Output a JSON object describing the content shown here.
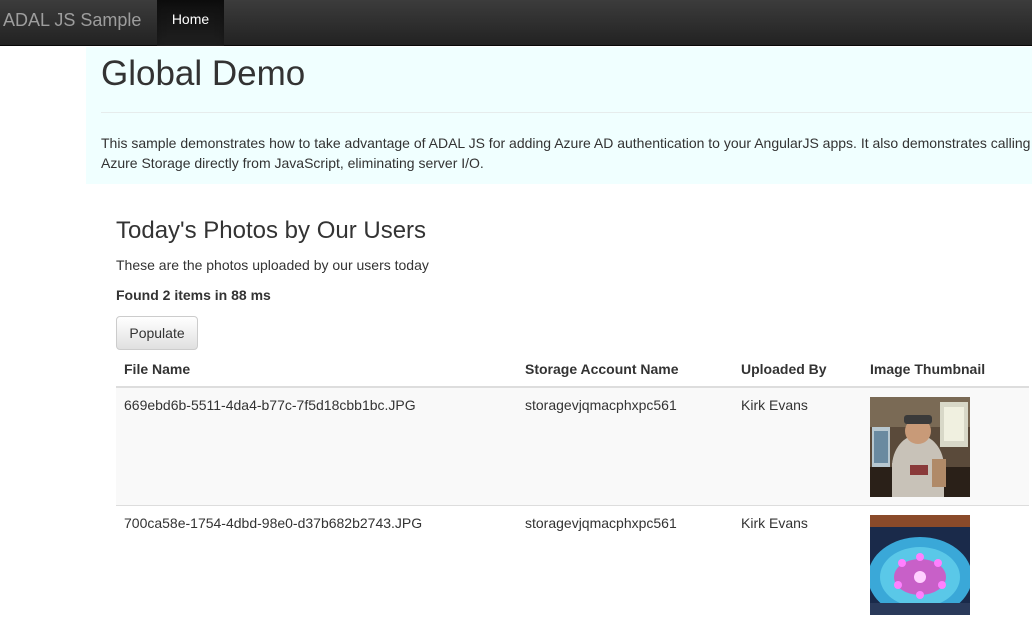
{
  "navbar": {
    "brand": "ADAL JS Sample",
    "home_label": "Home"
  },
  "jumbotron": {
    "title": "Global Demo",
    "description": "This sample demonstrates how to take advantage of ADAL JS for adding Azure AD authentication to your AngularJS apps. It also demonstrates calling Azure Storage directly from JavaScript, eliminating server I/O."
  },
  "photos": {
    "title": "Today's Photos by Our Users",
    "subtitle": "These are the photos uploaded by our users today",
    "found_text": "Found 2 items in 88 ms",
    "populate_label": "Populate",
    "columns": [
      "File Name",
      "Storage Account Name",
      "Uploaded By",
      "Image Thumbnail"
    ],
    "rows": [
      {
        "file_name": "669ebd6b-5511-4da4-b77c-7f5d18cbb1bc.JPG",
        "storage_account": "storagevjqmacphxpc561",
        "uploaded_by": "Kirk Evans",
        "thumbnail": "photo-person-indoors"
      },
      {
        "file_name": "700ca58e-1754-4dbd-98e0-d37b682b2743.JPG",
        "storage_account": "storagevjqmacphxpc561",
        "uploaded_by": "Kirk Evans",
        "thumbnail": "photo-fountain-lights"
      }
    ]
  },
  "colors": {
    "navbar": "#222222",
    "jumbotron_bg": "#f0ffff",
    "stripe": "#f9f9f9"
  }
}
